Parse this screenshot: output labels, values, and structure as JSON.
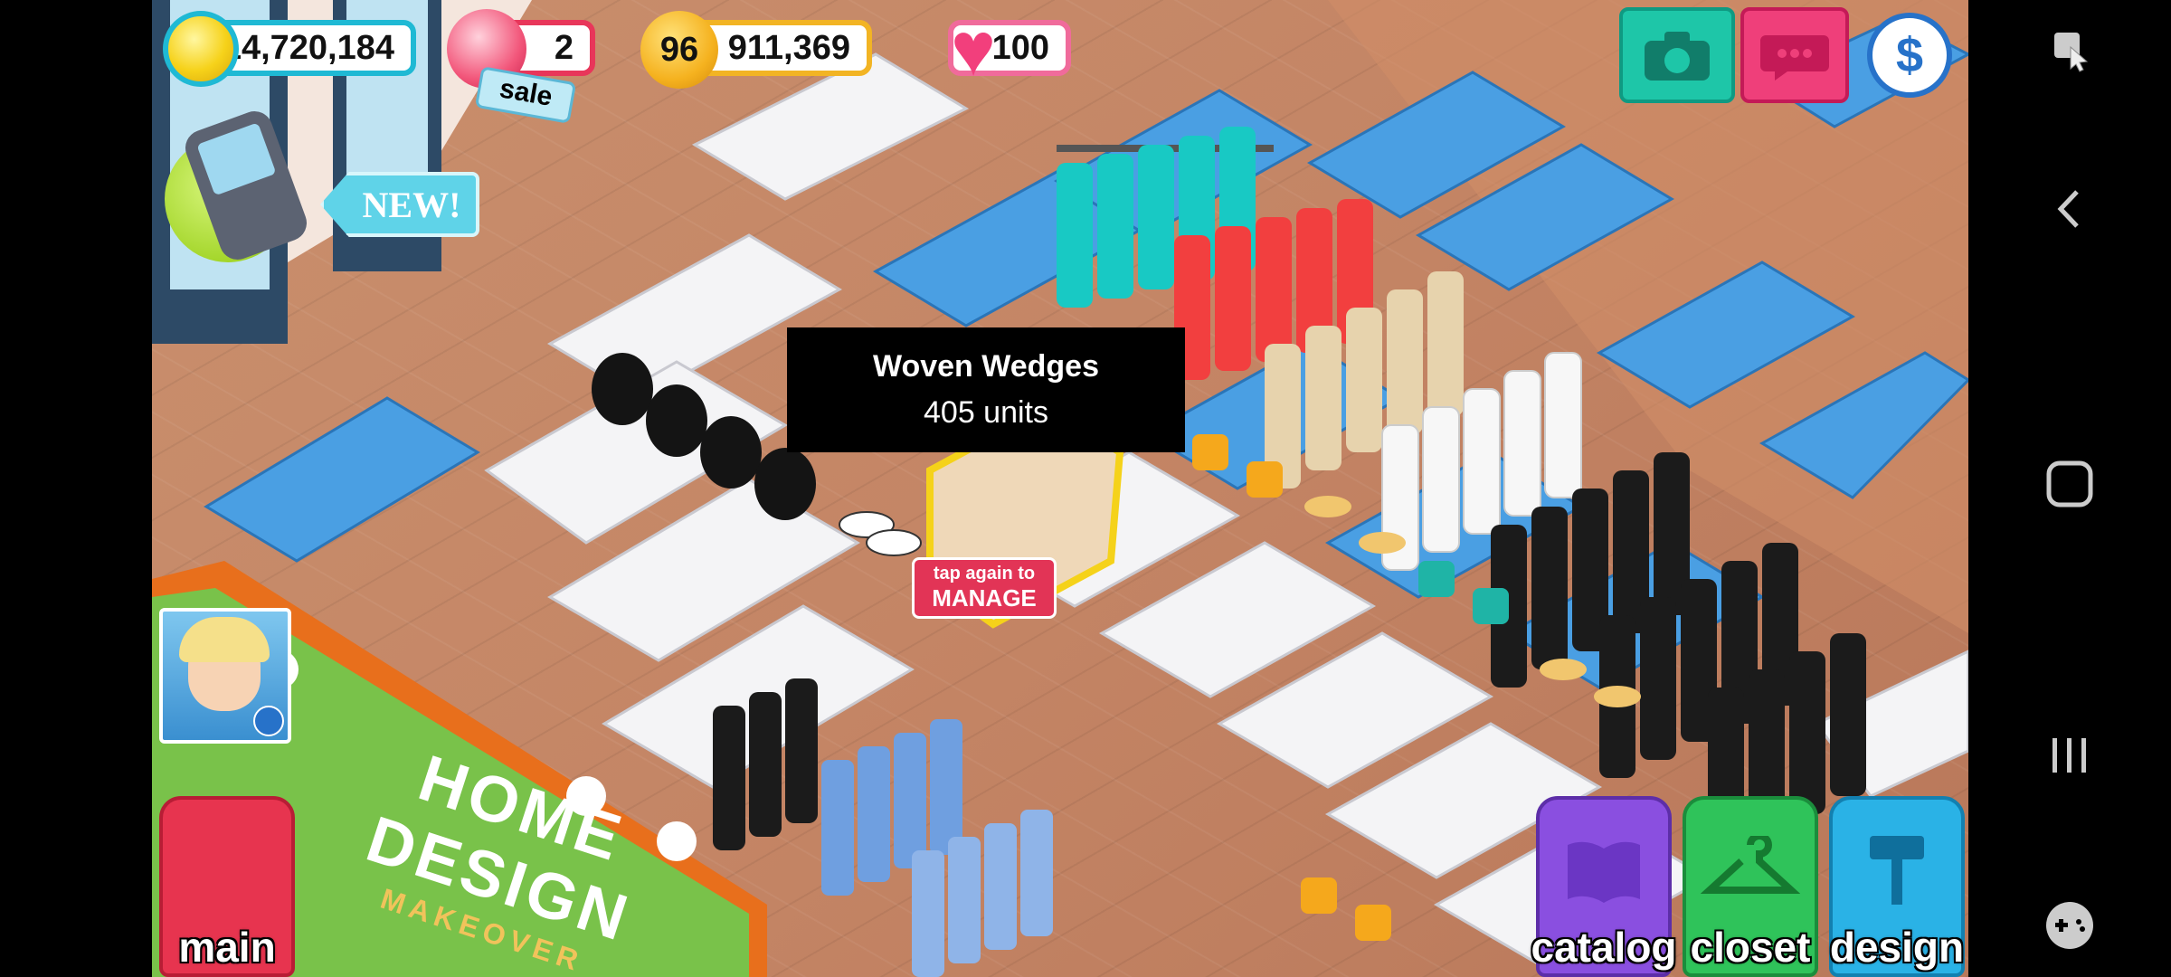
{
  "hud": {
    "coins": "14,720,184",
    "gems": "2",
    "sale_tag": "sale",
    "level": "96",
    "xp": "911,369",
    "hearts": "100",
    "new_badge": "NEW!"
  },
  "tooltip": {
    "title": "Woven Wedges",
    "subtitle": "405 units"
  },
  "manage_hint": {
    "line1": "tap again to",
    "line2": "MANAGE"
  },
  "billboard": {
    "line1": "HOME",
    "line2": "DESIGN",
    "line3": "MAKEOVER"
  },
  "bottom_buttons": {
    "main": "main",
    "catalog": "catalog",
    "closet": "closet",
    "design": "design"
  },
  "colors": {
    "floor": "#c48565",
    "coin_border": "#1fb9d4",
    "gem_border": "#e8365a",
    "xp_border": "#f2b424",
    "heart_border": "#f06b9b",
    "camera_btn": "#1ec6a8",
    "chat_btn": "#ef3f7a"
  }
}
